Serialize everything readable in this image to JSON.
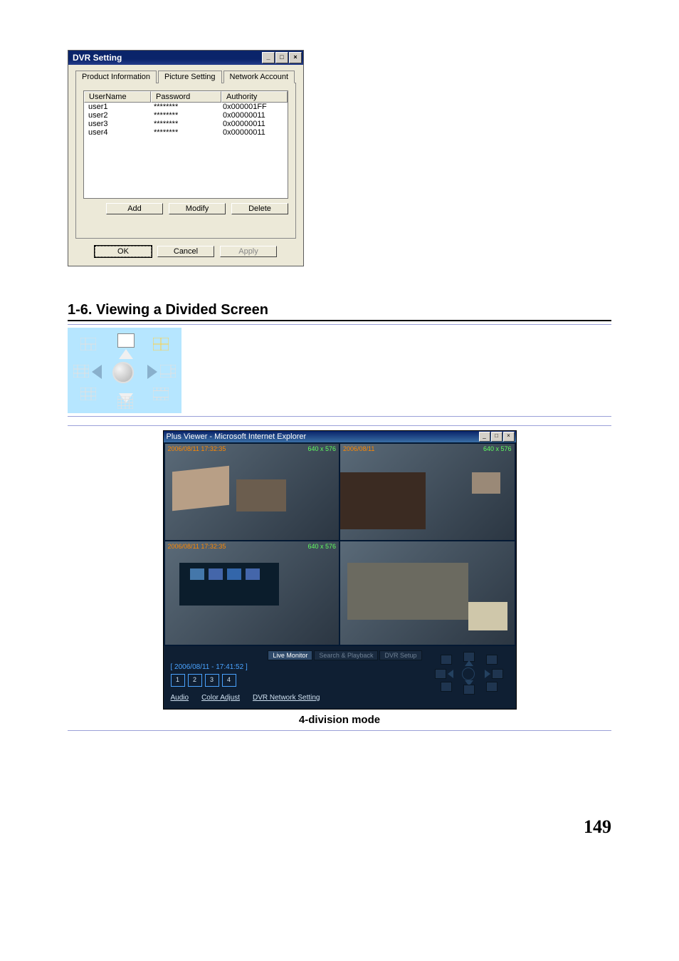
{
  "dvr": {
    "title": "DVR Setting",
    "winbtns": {
      "min": "_",
      "max": "□",
      "close": "×"
    },
    "tabs": {
      "product": "Product Information",
      "picture": "Picture Setting",
      "network": "Network Account"
    },
    "columns": {
      "user": "UserName",
      "pass": "Password",
      "auth": "Authority"
    },
    "rows": [
      {
        "user": "user1",
        "pass": "********",
        "auth": "0x000001FF"
      },
      {
        "user": "user2",
        "pass": "********",
        "auth": "0x00000011"
      },
      {
        "user": "user3",
        "pass": "********",
        "auth": "0x00000011"
      },
      {
        "user": "user4",
        "pass": "********",
        "auth": "0x00000011"
      }
    ],
    "buttons": {
      "add": "Add",
      "modify": "Modify",
      "delete": "Delete",
      "ok": "OK",
      "cancel": "Cancel",
      "apply": "Apply"
    }
  },
  "section": {
    "heading": "1-6. Viewing a Divided Screen"
  },
  "pad": {
    "icons": {
      "topL": "grid-7-icon",
      "topC": "single-icon",
      "topR": "grid-4-icon",
      "midL": "grid-10-icon",
      "midR": "grid-6-icon",
      "botL": "grid-9-icon",
      "botC": "grid-16-icon",
      "botR": "grid-13-icon"
    }
  },
  "viewer": {
    "title": "Plus Viewer - Microsoft Internet Explorer",
    "winbtns": {
      "min": "_",
      "max": "□",
      "close": "×"
    },
    "cells": [
      {
        "ts": "2006/08/11 17:32:35",
        "res": "640 x 576"
      },
      {
        "ts": "2006/08/11",
        "res": "640 x 576"
      },
      {
        "ts": "2006/08/11 17:32:35",
        "res": "640 x 576"
      },
      {
        "ts": "",
        "res": ""
      }
    ],
    "tabs": {
      "live": "Live Monitor",
      "search": "Search & Playback",
      "dvrset": "DVR Setup"
    },
    "timestamp2": "[ 2006/08/11 - 17:41:52 ]",
    "channels": [
      "1",
      "2",
      "3",
      "4"
    ],
    "links": {
      "audio": "Audio",
      "color": "Color Adjust",
      "net": "DVR Network Setting"
    },
    "caption": "4-division mode"
  },
  "page_number": "149"
}
